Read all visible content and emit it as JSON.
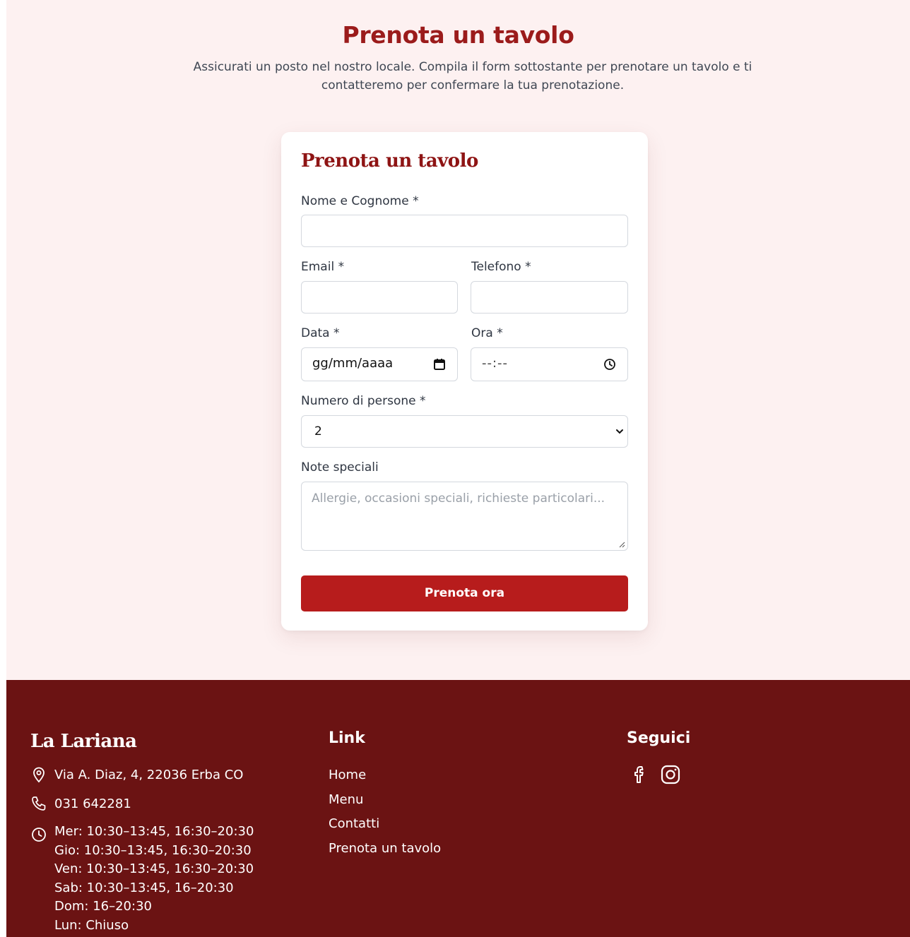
{
  "hero": {
    "title": "Prenota un tavolo",
    "subtitle": "Assicurati un posto nel nostro locale. Compila il form sottostante per prenotare un tavolo e ti contatteremo per confermare la tua prenotazione."
  },
  "form": {
    "title": "Prenota un tavolo",
    "name_label": "Nome e Cognome *",
    "email_label": "Email *",
    "phone_label": "Telefono *",
    "date_label": "Data *",
    "date_value": "gg/mm/aaaa",
    "time_label": "Ora *",
    "time_value": "--:--",
    "people_label": "Numero di persone *",
    "people_value": "2",
    "notes_label": "Note speciali",
    "notes_placeholder": "Allergie, occasioni speciali, richieste particolari...",
    "submit_label": "Prenota ora"
  },
  "footer": {
    "brand": "La Lariana",
    "address": "Via A. Diaz, 4, 22036 Erba CO",
    "phone": "031 642281",
    "hours": [
      "Mer: 10:30–13:45, 16:30–20:30",
      "Gio: 10:30–13:45, 16:30–20:30",
      "Ven: 10:30–13:45, 16:30–20:30",
      "Sab: 10:30–13:45, 16–20:30",
      "Dom: 16–20:30",
      "Lun: Chiuso"
    ],
    "links_title": "Link",
    "links": [
      "Home",
      "Menu",
      "Contatti",
      "Prenota un tavolo"
    ],
    "social_title": "Seguici",
    "social": [
      "facebook-icon",
      "instagram-icon"
    ]
  },
  "colors": {
    "accent": "#b71c1c",
    "heading": "#9b1b1b",
    "footer_bg": "#6b1313",
    "page_bg": "#fdf1f1"
  }
}
